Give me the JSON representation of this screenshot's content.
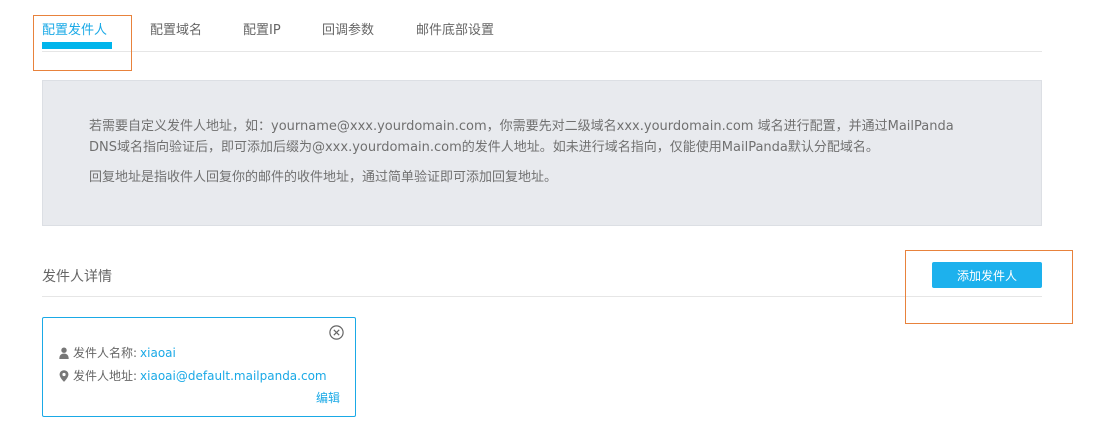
{
  "tabs": [
    {
      "label": "配置发件人",
      "active": true
    },
    {
      "label": "配置域名",
      "active": false
    },
    {
      "label": "配置IP",
      "active": false
    },
    {
      "label": "回调参数",
      "active": false
    },
    {
      "label": "邮件底部设置",
      "active": false
    }
  ],
  "notice": {
    "line1": "若需要自定义发件人地址，如：yourname@xxx.yourdomain.com，你需要先对二级域名xxx.yourdomain.com 域名进行配置，并通过MailPanda",
    "line2": "DNS域名指向验证后，即可添加后缀为@xxx.yourdomain.com的发件人地址。如未进行域名指向，仅能使用MailPanda默认分配域名。",
    "line3": "回复地址是指收件人回复你的邮件的收件地址，通过简单验证即可添加回复地址。"
  },
  "section": {
    "title": "发件人详情",
    "add_button": "添加发件人"
  },
  "sender_card": {
    "name_label": "发件人名称:",
    "name_value": "xiaoai",
    "address_label": "发件人地址:",
    "address_value": "xiaoai@default.mailpanda.com",
    "edit_label": "编辑",
    "close_icon": "close-circle-icon",
    "name_icon": "user-icon",
    "address_icon": "map-pin-icon"
  },
  "colors": {
    "accent": "#1aa9e6",
    "button": "#1db1ed",
    "tab_underline": "#00b5ec",
    "notice_bg": "#e8eaee",
    "highlight_outline": "#e8823c"
  }
}
